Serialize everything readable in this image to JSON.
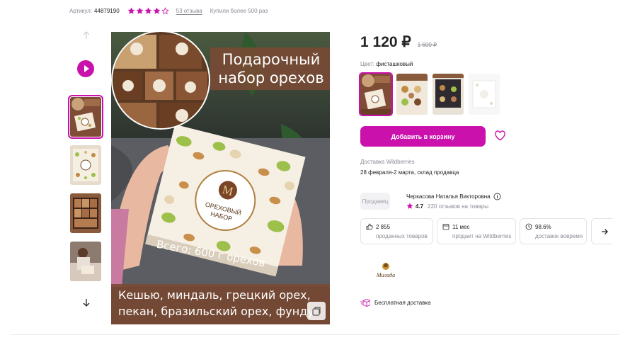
{
  "header": {
    "article_label": "Артикул:",
    "article_value": "44879190",
    "rating_stars": 4,
    "reviews_link": "53 отзыва",
    "bought_text": "Купили более 500 раз"
  },
  "gallery": {
    "thumbnails": [
      {
        "name": "box-with-nuts",
        "active": true
      },
      {
        "name": "nut-assortment"
      },
      {
        "name": "gift-box-brown"
      },
      {
        "name": "person-holding-box"
      }
    ]
  },
  "main_image": {
    "banner_title_line1": "Подарочный",
    "banner_title_line2": "набор орехов",
    "box_logo_letter": "M",
    "box_label_line1": "ОРЕХОВЫЙ",
    "box_label_line2": "НАБОР",
    "weight_text": "Всего: 600 г орехов",
    "bottom_caption_line1": "Кешью, миндаль, грецкий орех,",
    "bottom_caption_line2": "пекан, бразильский орех, фунду"
  },
  "product": {
    "price": "1 120 ₽",
    "old_price": "1 600 ₽",
    "color_label": "Цвет:",
    "color_value": "фисташковый",
    "variants": [
      "box-with-nuts",
      "nut-assortment",
      "dark-gift-box",
      "white-gift-box"
    ]
  },
  "actions": {
    "add_to_cart": "Добавить в корзину",
    "favorite_icon": "heart-icon"
  },
  "delivery": {
    "label": "Доставка Wildberries",
    "dates": "28 февраля-2 марта, склад продавца"
  },
  "seller": {
    "badge": "Продавец",
    "name": "Черкасова Наталья Викторовна",
    "rating": "4.7",
    "reviews": "220 отзывов на товары"
  },
  "stats": [
    {
      "value": "2 855",
      "label": "проданных товаров",
      "icon": "thumbs-up-icon"
    },
    {
      "value": "11 мес",
      "label": "продает на Wildberries",
      "icon": "calendar-icon"
    },
    {
      "value": "98.6%",
      "label": "доставок вовремя",
      "icon": "clock-icon"
    }
  ],
  "brand": {
    "name": "Милада"
  },
  "free_delivery": "Бесплатная доставка",
  "colors": {
    "accent": "#cb11ab",
    "star": "#cb11ab",
    "muted_text": "#8a8a95",
    "banner_brown": "#7a4a34"
  }
}
